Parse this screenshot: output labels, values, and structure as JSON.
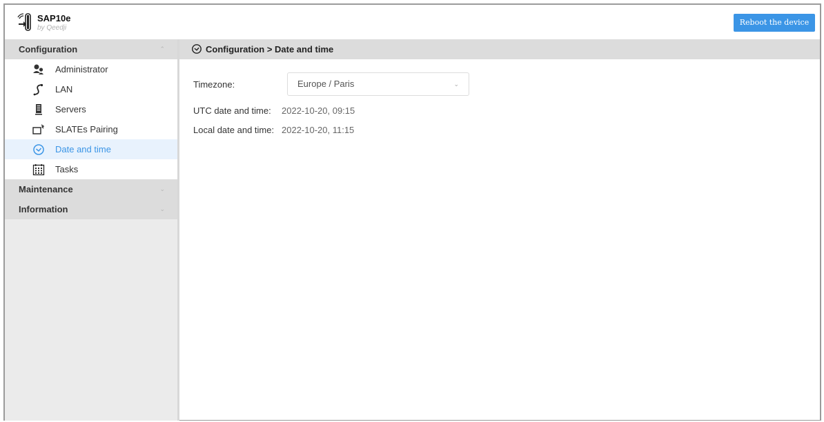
{
  "app": {
    "title": "SAP10e",
    "subtitle": "by Qeedji",
    "reboot_label": "Reboot the device"
  },
  "sidebar": {
    "sections": [
      {
        "label": "Configuration",
        "expanded": true,
        "chevron": "^",
        "items": [
          {
            "label": "Administrator",
            "icon": "administrator-icon"
          },
          {
            "label": "LAN",
            "icon": "lan-icon"
          },
          {
            "label": "Servers",
            "icon": "servers-icon"
          },
          {
            "label": "SLATEs Pairing",
            "icon": "slates-pairing-icon"
          },
          {
            "label": "Date and time",
            "icon": "clock-icon",
            "active": true
          },
          {
            "label": "Tasks",
            "icon": "calendar-icon"
          }
        ]
      },
      {
        "label": "Maintenance",
        "expanded": false,
        "chevron": "v"
      },
      {
        "label": "Information",
        "expanded": false,
        "chevron": "v"
      }
    ]
  },
  "main": {
    "breadcrumb": "Configuration > Date and time",
    "fields": {
      "timezone_label": "Timezone:",
      "timezone_value": "Europe / Paris",
      "utc_label": "UTC date and time:",
      "utc_value": "2022-10-20, 09:15",
      "local_label": "Local date and time:",
      "local_value": "2022-10-20, 11:15"
    }
  },
  "colors": {
    "accent": "#3b95e6",
    "active_bg": "#e8f2fd",
    "section_bg": "#dcdcdc",
    "sidebar_bg": "#ebebeb"
  }
}
